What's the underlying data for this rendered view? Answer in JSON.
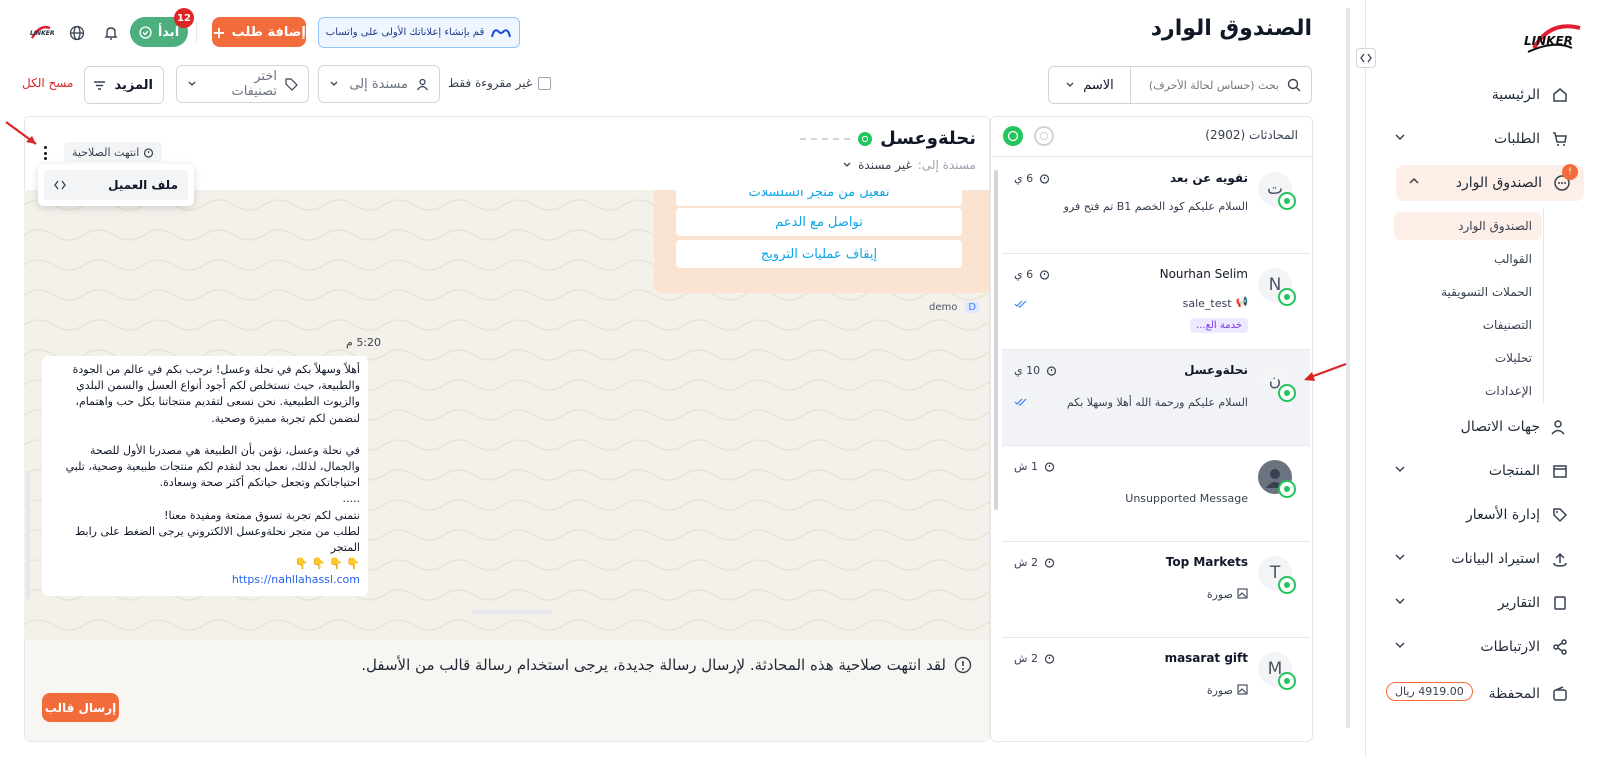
{
  "sidebar": {
    "logo_text": "LINKER",
    "items": [
      {
        "label": "الرئيسية",
        "icon": "home-icon"
      },
      {
        "label": "الطلبات",
        "icon": "cart-icon"
      },
      {
        "label": "الصندوق الوارد",
        "icon": "chat-icon",
        "badge": "!"
      },
      {
        "label": "جهات الاتصال",
        "icon": "users-icon"
      },
      {
        "label": "المنتجات",
        "icon": "box-icon"
      },
      {
        "label": "إدارة الأسعار",
        "icon": "tag-icon"
      },
      {
        "label": "استيراد البيانات",
        "icon": "upload-icon"
      },
      {
        "label": "التقارير",
        "icon": "report-icon"
      },
      {
        "label": "الارتباطات",
        "icon": "share-icon"
      },
      {
        "label": "المحفظة",
        "icon": "wallet-icon"
      }
    ],
    "inbox_sub": [
      "الصندوق الوارد",
      "القوالب",
      "الحملات التسويقية",
      "التصنيفات",
      "تحليلات",
      "الإعدادات"
    ],
    "wallet_balance": "4919.00 ريال"
  },
  "header": {
    "title": "الصندوق الوارد",
    "meta_banner": "قم بإنشاء إعلاناتك الأولى على واتساب",
    "add_order": "إضافة طلب",
    "start_label": "ابدأ",
    "start_badge": "12",
    "logo_small": "LINKER"
  },
  "filters": {
    "search_placeholder": "بحث (حساس لحالة الأحرف)",
    "search_type": "الاسم",
    "unread_only": "غير مقروءة فقط",
    "assigned_to": "مسندة إلى",
    "tags": "اختر تصنيفات",
    "more": "المزيد",
    "clear_all": "مسح الكل"
  },
  "conversations": {
    "header": "المحادثات (2902)",
    "items": [
      {
        "avatar": "ت",
        "name": "تقويه عن بعد",
        "time": "6 ي",
        "preview": "السلام عليكم كود الخصم B1 تم فتح فرو"
      },
      {
        "avatar": "N",
        "name": "Nourhan Selim",
        "time": "6 ي",
        "preview": "sale_test",
        "tag": "خدمة الع..."
      },
      {
        "avatar": "ن",
        "name": "نحلةوعسل",
        "time": "10 ي",
        "preview": "السلام عليكم ورحمة الله أهلا وسهلا بكم"
      },
      {
        "avatar": "",
        "name": "",
        "time": "1 ش",
        "preview": "Unsupported Message"
      },
      {
        "avatar": "T",
        "name": "Top Markets",
        "time": "2 ش",
        "preview": "صورة"
      },
      {
        "avatar": "M",
        "name": "masarat gift",
        "time": "2 ش",
        "preview": "صورة"
      }
    ]
  },
  "chat": {
    "contact_name": "نحلةوعسل",
    "assigned_label": "مسندة إلى:",
    "assigned_value": "غير مسندة",
    "expired_badge": "انتهت الصلاحية",
    "menu_item": "ملف العميل",
    "quick_replies": [
      "تفعيل من متجر السلسلات",
      "تواصل مع الدعم",
      "إيقاف عمليات الترويج"
    ],
    "sender": "demo",
    "sender_initial": "D",
    "time": "5:20 م",
    "message_p1": "أهلاً وسهلاً بكم في نحلة وعسل! نرحب بكم في عالم من الجودة والطبيعة، حيث نستخلص لكم أجود أنواع العسل والسمن البلدي والزيوت الطبيعية. نحن نسعى لتقديم منتجاتنا بكل حب واهتمام، لنضمن لكم تجربة مميزة وصحية.",
    "message_p2": "في نحلة وعسل، نؤمن بأن الطبيعة هي مصدرنا الأول للصحة والجمال، لذلك، نعمل بجد لنقدم لكم منتجات طبيعية وصحية، تلبي احتياجاتكم وتجعل حياتكم أكثر صحة وسعادة.",
    "message_dots": ".....",
    "message_p3": "نتمنى لكم تجربة تسوق ممتعة ومفيدة معنا!",
    "message_p4": "لطلب من متجر نحلةوعسل الالكتروني يرجى الضغط على رابط المتجر",
    "message_emoji": "👇 👇 👇 👇",
    "message_link": "https://nahllahassl.com",
    "expired_notice": "لقد انتهت صلاحية هذه المحادثة. لإرسال رسالة جديدة، يرجى استخدام رسالة قالب من الأسفل.",
    "send_template": "إرسال قالب"
  },
  "colors": {
    "accent": "#f26b3a",
    "green": "#22c55e",
    "active_bg": "#fdeee7"
  }
}
